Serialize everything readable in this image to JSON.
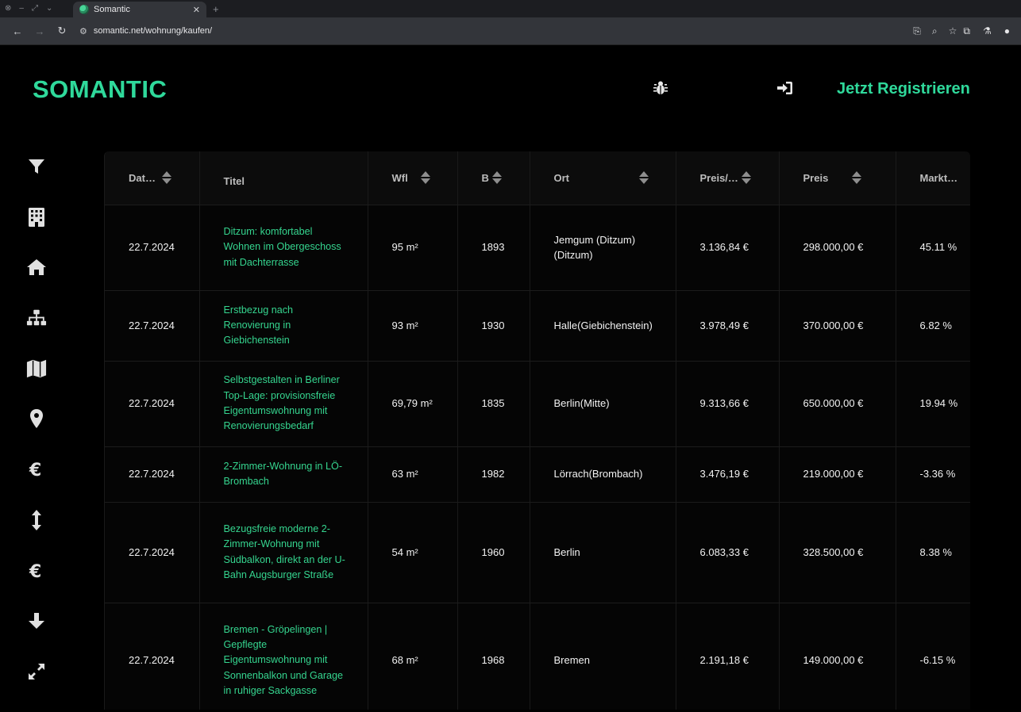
{
  "browser": {
    "tab_title": "Somantic",
    "url": "somantic.net/wohnung/kaufen/"
  },
  "app": {
    "logo": "SOMANTIC",
    "register_label": "Jetzt Registrieren",
    "header_icons": [
      "bug-icon",
      "info-icon",
      "login-icon"
    ],
    "sidebar_icons": [
      "filter-icon",
      "building-icon",
      "home-icon",
      "sitemap-icon",
      "map-icon",
      "location-pin-icon",
      "euro-icon",
      "height-arrows-icon",
      "euro-icon",
      "arrow-down-icon",
      "expand-icon"
    ],
    "accent_color": "#2fd99b"
  },
  "table": {
    "columns": [
      "Dat…",
      "Titel",
      "Wfl",
      "B",
      "Ort",
      "Preis/…",
      "Preis",
      "Markt…"
    ],
    "rows": [
      [
        "22.7.2024",
        "Ditzum: komfortabel Wohnen im Obergeschoss mit Dachterrasse",
        "95 m²",
        "1893",
        "Jemgum (Ditzum) (Ditzum)",
        "3.136,84 €",
        "298.000,00 €",
        "45.11 %"
      ],
      [
        "22.7.2024",
        "Erstbezug nach Renovierung in Giebichenstein",
        "93 m²",
        "1930",
        "Halle(Giebichenstein)",
        "3.978,49 €",
        "370.000,00 €",
        "6.82 %"
      ],
      [
        "22.7.2024",
        "Selbstgestalten in Berliner Top-Lage: provisionsfreie Eigentumswohnung mit Renovierungsbedarf",
        "69,79 m²",
        "1835",
        "Berlin(Mitte)",
        "9.313,66 €",
        "650.000,00 €",
        "19.94 %"
      ],
      [
        "22.7.2024",
        "2-Zimmer-Wohnung in LÖ-Brombach",
        "63 m²",
        "1982",
        "Lörrach(Brombach)",
        "3.476,19 €",
        "219.000,00 €",
        "-3.36 %"
      ],
      [
        "22.7.2024",
        "Bezugsfreie moderne 2-Zimmer-Wohnung mit Südbalkon, direkt an der U-Bahn Augsburger Straße",
        "54 m²",
        "1960",
        "Berlin",
        "6.083,33 €",
        "328.500,00 €",
        "8.38 %"
      ],
      [
        "22.7.2024",
        "Bremen - Gröpelingen | Gepflegte Eigentumswohnung mit Sonnenbalkon und Garage in ruhiger Sackgasse",
        "68 m²",
        "1968",
        "Bremen",
        "2.191,18 €",
        "149.000,00 €",
        "-6.15 %"
      ]
    ]
  }
}
